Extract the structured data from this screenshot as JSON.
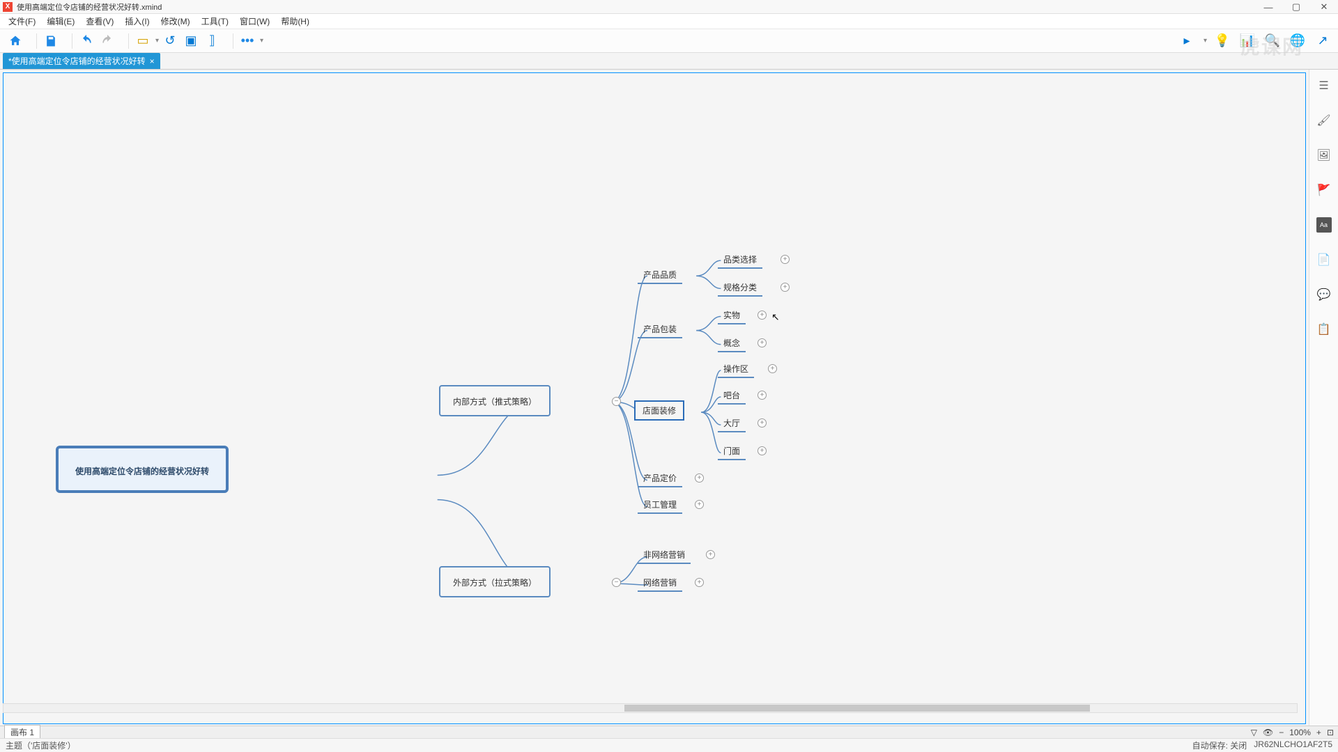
{
  "title": "使用高端定位令店铺的经营状况好转.xmind",
  "menu": [
    "文件(F)",
    "编辑(E)",
    "查看(V)",
    "插入(I)",
    "修改(M)",
    "工具(T)",
    "窗口(W)",
    "帮助(H)"
  ],
  "tab": "*使用高端定位令店铺的经营状况好转",
  "sheet": "画布 1",
  "status_left": "主题（'店面装修'）",
  "status_right": {
    "autosave": "自动保存: 关闭",
    "code": "JR62NLCHO1AF2T5"
  },
  "zoom": "100%",
  "mindmap": {
    "root": "使用高端定位令店铺的经营状况好转",
    "branches": [
      {
        "label": "内部方式（推式策略）",
        "children": [
          {
            "label": "产品品质",
            "children": [
              "品类选择",
              "规格分类"
            ]
          },
          {
            "label": "产品包装",
            "children": [
              "实物",
              "概念"
            ]
          },
          {
            "label": "店面装修",
            "selected": true,
            "children": [
              "操作区",
              "吧台",
              "大厅",
              "门面"
            ]
          },
          {
            "label": "产品定价",
            "children": []
          },
          {
            "label": "员工管理",
            "children": []
          }
        ]
      },
      {
        "label": "外部方式（拉式策略）",
        "children": [
          {
            "label": "非网络营销",
            "children": []
          },
          {
            "label": "网络营销",
            "children": []
          }
        ]
      }
    ]
  },
  "watermark": "虎课网"
}
